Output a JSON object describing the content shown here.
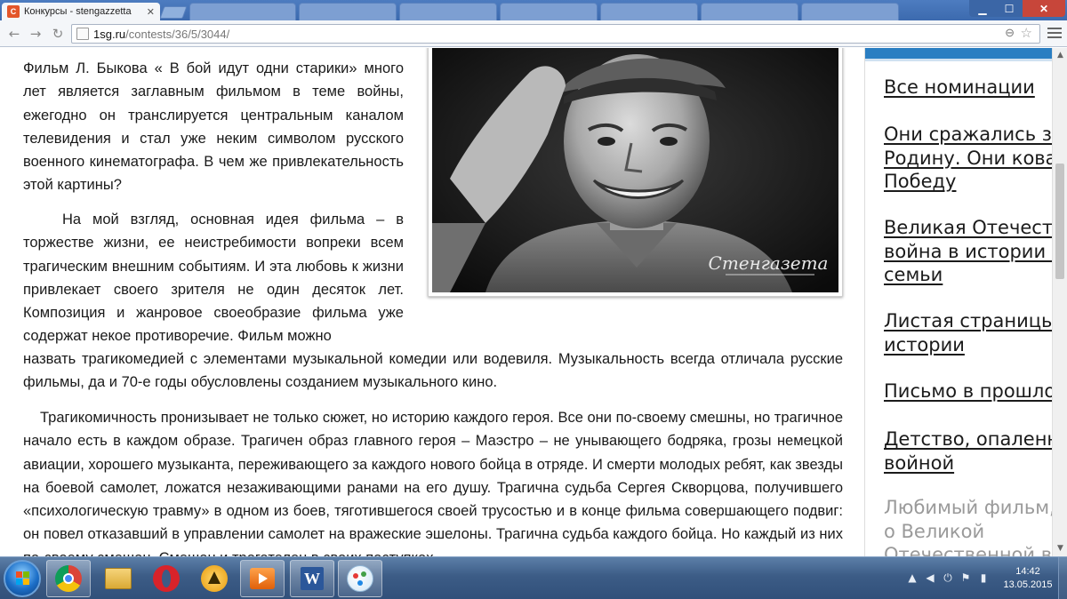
{
  "browser": {
    "active_tab_title": "Конкурсы - stengazzetta",
    "address_host": "1sg.ru",
    "address_path": "/contests/36/5/3044/",
    "icons": {
      "back": "back-arrow-icon",
      "forward": "forward-arrow-icon",
      "reload": "reload-icon",
      "zoom": "zoom-icon",
      "bookmark": "star-icon",
      "menu": "hamburger-menu-icon"
    }
  },
  "article": {
    "para1": "Фильм Л. Быкова « В бой идут одни старики» много лет является заглавным фильмом в теме войны, ежегодно он транслируется центральным каналом телевидения и стал уже неким символом русского военного кинематографа. В чем же привлекательность этой картины?",
    "para2": "На мой взгляд, основная идея фильма – в торжестве жизни, ее неистребимости вопреки всем трагическим внешним событиям. И эта любовь к жизни привлекает своего зрителя не один десяток лет. Композиция и жанровое своеобразие фильма уже содержат некое противоречие. Фильм можно",
    "para2_cont": "назвать трагикомедией с элементами музыкальной комедии или водевиля. Музыкальность всегда отличала русские фильмы, да и 70-е годы обусловлены созданием музыкального кино.",
    "para3": "Трагикомичность пронизывает не только сюжет, но историю каждого героя. Все они по-своему смешны, но трагичное начало есть в каждом образе. Трагичен образ главного героя – Маэстро – не унывающего бодряка, грозы немецкой авиации, хорошего музыканта, переживающего за каждого нового бойца в отряде. И смерти молодых ребят, как звезды на боевой самолет, ложатся незаживающими ранами на его душу. Трагична судьба Сергея Скворцова, получившего «психологическую травму» в одном из боев, тяготившегося своей трусостью и в конце фильма совершающего подвиг: он повел отказавший в управлении самолет на вражеские эшелоны. Трагична судьба каждого бойца. Но каждый из них по-своему смешон. Смешон и трогателен в своих поступках.",
    "photo_watermark": "Стенгазета"
  },
  "sidebar": {
    "links": [
      {
        "lines": [
          "Все номинации"
        ]
      },
      {
        "lines": [
          "Они сражались за",
          "Родину. Они ковали",
          "Победу"
        ]
      },
      {
        "lines": [
          "Великая Отечественная",
          "война в истории моей",
          "семьи"
        ]
      },
      {
        "lines": [
          "Листая страницы",
          "истории"
        ]
      },
      {
        "lines": [
          "Письмо в прошлое"
        ]
      },
      {
        "lines": [
          "Детство, опаленное",
          "войной"
        ]
      },
      {
        "lines": [
          "Любимый фильм, книга",
          "о Великой",
          "Отечественной войне"
        ]
      }
    ]
  },
  "taskbar": {
    "apps": [
      "chrome-icon",
      "file-explorer-icon",
      "opera-icon",
      "aimp-icon",
      "media-player-icon",
      "word-icon",
      "paint-icon"
    ],
    "clock_time": "14:42",
    "clock_date": "13.05.2015"
  }
}
